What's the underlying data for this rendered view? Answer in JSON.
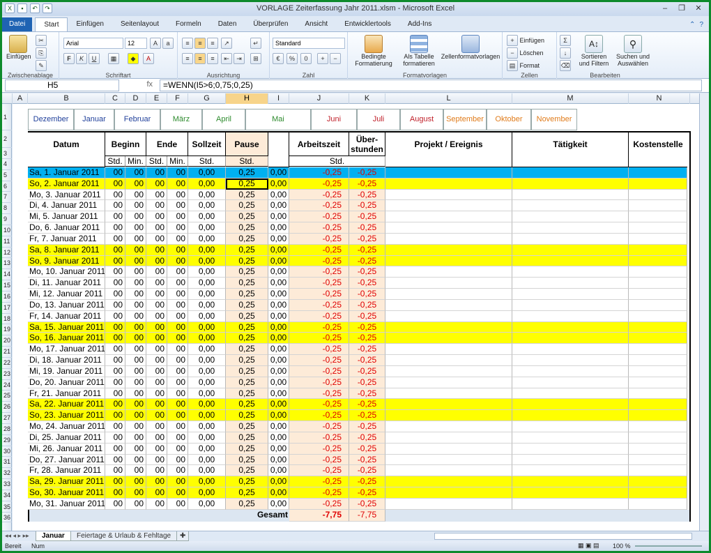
{
  "window": {
    "title": "VORLAGE Zeiterfassung Jahr 2011.xlsm - Microsoft Excel"
  },
  "ribbon_tabs": [
    "Datei",
    "Start",
    "Einfügen",
    "Seitenlayout",
    "Formeln",
    "Daten",
    "Überprüfen",
    "Ansicht",
    "Entwicklertools",
    "Add-Ins"
  ],
  "ribbon": {
    "clipboard": {
      "paste": "Einfügen",
      "label": "Zwischenablage"
    },
    "font": {
      "name": "Arial",
      "size": "12",
      "bold": "F",
      "italic": "K",
      "underline": "U",
      "label": "Schriftart"
    },
    "alignment": {
      "label": "Ausrichtung"
    },
    "number": {
      "format": "Standard",
      "label": "Zahl"
    },
    "styles": {
      "cond": "Bedingte Formatierung",
      "table": "Als Tabelle formatieren",
      "cellstyles": "Zellenformatvorlagen",
      "label": "Formatvorlagen"
    },
    "cells": {
      "insert": "Einfügen",
      "delete": "Löschen",
      "format": "Format",
      "label": "Zellen"
    },
    "editing": {
      "sort": "Sortieren und Filtern",
      "find": "Suchen und Auswählen",
      "label": "Bearbeiten"
    }
  },
  "formula_bar": {
    "name_box": "H5",
    "fx": "fx",
    "formula": "=WENN(I5>6;0,75;0,25)"
  },
  "columns": [
    "A",
    "B",
    "C",
    "D",
    "E",
    "F",
    "G",
    "H",
    "I",
    "J",
    "K",
    "L",
    "M",
    "N"
  ],
  "month_tabs": [
    {
      "label": "Dezember",
      "color": "#1f3f9a"
    },
    {
      "label": "Januar",
      "color": "#1f3f9a"
    },
    {
      "label": "Februar",
      "color": "#1f3f9a"
    },
    {
      "label": "März",
      "color": "#2e8b2e"
    },
    {
      "label": "April",
      "color": "#2e8b2e"
    },
    {
      "label": "Mai",
      "color": "#2e8b2e"
    },
    {
      "label": "Juni",
      "color": "#c0202a"
    },
    {
      "label": "Juli",
      "color": "#c0202a"
    },
    {
      "label": "August",
      "color": "#c0202a"
    },
    {
      "label": "September",
      "color": "#e07b1a"
    },
    {
      "label": "Oktober",
      "color": "#e07b1a"
    },
    {
      "label": "November",
      "color": "#e07b1a"
    }
  ],
  "headers": {
    "datum": "Datum",
    "beginn": "Beginn",
    "ende": "Ende",
    "sollzeit": "Sollzeit",
    "pause": "Pause",
    "arbeitszeit": "Arbeitszeit",
    "ueberstunden": "Über-\nstunden",
    "projekt": "Projekt / Ereignis",
    "taetigkeit": "Tätigkeit",
    "kostenstelle": "Kostenstelle"
  },
  "subheaders": {
    "std": "Std.",
    "min": "Min."
  },
  "rows": [
    {
      "d": "Sa, 1. Januar 2011",
      "t": "sel"
    },
    {
      "d": "So, 2. Januar 2011",
      "t": "we"
    },
    {
      "d": "Mo, 3. Januar 2011",
      "t": "wd"
    },
    {
      "d": "Di, 4. Januar 2011",
      "t": "wd"
    },
    {
      "d": "Mi, 5. Januar 2011",
      "t": "wd"
    },
    {
      "d": "Do, 6. Januar 2011",
      "t": "wd"
    },
    {
      "d": "Fr, 7. Januar 2011",
      "t": "wd"
    },
    {
      "d": "Sa, 8. Januar 2011",
      "t": "we"
    },
    {
      "d": "So, 9. Januar 2011",
      "t": "we"
    },
    {
      "d": "Mo, 10. Januar 2011",
      "t": "wd"
    },
    {
      "d": "Di, 11. Januar 2011",
      "t": "wd"
    },
    {
      "d": "Mi, 12. Januar 2011",
      "t": "wd"
    },
    {
      "d": "Do, 13. Januar 2011",
      "t": "wd"
    },
    {
      "d": "Fr, 14. Januar 2011",
      "t": "wd"
    },
    {
      "d": "Sa, 15. Januar 2011",
      "t": "we"
    },
    {
      "d": "So, 16. Januar 2011",
      "t": "we"
    },
    {
      "d": "Mo, 17. Januar 2011",
      "t": "wd"
    },
    {
      "d": "Di, 18. Januar 2011",
      "t": "wd"
    },
    {
      "d": "Mi, 19. Januar 2011",
      "t": "wd"
    },
    {
      "d": "Do, 20. Januar 2011",
      "t": "wd"
    },
    {
      "d": "Fr, 21. Januar 2011",
      "t": "wd"
    },
    {
      "d": "Sa, 22. Januar 2011",
      "t": "we"
    },
    {
      "d": "So, 23. Januar 2011",
      "t": "we"
    },
    {
      "d": "Mo, 24. Januar 2011",
      "t": "wd"
    },
    {
      "d": "Di, 25. Januar 2011",
      "t": "wd"
    },
    {
      "d": "Mi, 26. Januar 2011",
      "t": "wd"
    },
    {
      "d": "Do, 27. Januar 2011",
      "t": "wd"
    },
    {
      "d": "Fr, 28. Januar 2011",
      "t": "wd"
    },
    {
      "d": "Sa, 29. Januar 2011",
      "t": "we"
    },
    {
      "d": "So, 30. Januar 2011",
      "t": "we"
    },
    {
      "d": "Mo, 31. Januar 2011",
      "t": "wd"
    }
  ],
  "cell_values": {
    "hour": "00",
    "min": "00",
    "soll": "0,00",
    "pause": "0,25",
    "i": "0,00",
    "arbeit": "-0,25",
    "ueber": "-0,25"
  },
  "total": {
    "label": "Gesamt",
    "arbeit": "-7,75",
    "ueber": "-7,75"
  },
  "sheet_tabs": [
    "Januar",
    "Feiertage & Urlaub & Fehltage"
  ],
  "status": {
    "ready": "Bereit",
    "num": "Num",
    "zoom": "100 %"
  }
}
